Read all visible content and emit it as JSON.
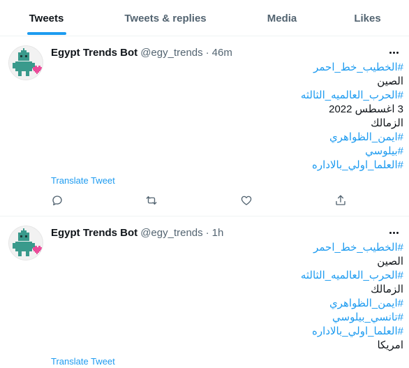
{
  "tabs": [
    {
      "label": "Tweets",
      "active": true
    },
    {
      "label": "Tweets & replies",
      "active": false
    },
    {
      "label": "Media",
      "active": false
    },
    {
      "label": "Likes",
      "active": false
    }
  ],
  "tweets": [
    {
      "display_name": "Egypt Trends Bot",
      "handle": "@egy_trends",
      "separator": "·",
      "time": "46m",
      "lines": [
        {
          "text": "#الخطيب_خط_احمر",
          "hashtag": true
        },
        {
          "text": "الصين",
          "hashtag": false
        },
        {
          "text": "#الحرب_العالميه_الثالثه",
          "hashtag": true
        },
        {
          "text": "3 اغسطس 2022",
          "hashtag": false
        },
        {
          "text": "الزمالك",
          "hashtag": false
        },
        {
          "text": "#ايمن_الظواهري",
          "hashtag": true
        },
        {
          "text": "#بيلوسي",
          "hashtag": true
        },
        {
          "text": "#العلما_اولي_بالاداره",
          "hashtag": true
        }
      ],
      "translate_label": "Translate Tweet"
    },
    {
      "display_name": "Egypt Trends Bot",
      "handle": "@egy_trends",
      "separator": "·",
      "time": "1h",
      "lines": [
        {
          "text": "#الخطيب_خط_احمر",
          "hashtag": true
        },
        {
          "text": "الصين",
          "hashtag": false
        },
        {
          "text": "#الحرب_العالميه_الثالثه",
          "hashtag": true
        },
        {
          "text": "الزمالك",
          "hashtag": false
        },
        {
          "text": "#ايمن_الظواهري",
          "hashtag": true
        },
        {
          "text": "#تانسي_بيلوسي",
          "hashtag": true
        },
        {
          "text": "#العلما_اولي_بالاداره",
          "hashtag": true
        },
        {
          "text": "امريكا",
          "hashtag": false
        }
      ],
      "translate_label": "Translate Tweet"
    }
  ],
  "actions": [
    "reply-icon",
    "retweet-icon",
    "like-icon",
    "share-icon"
  ],
  "colors": {
    "accent": "#1d9bf0",
    "text": "#0f1419",
    "secondary": "#536471",
    "divider": "#eff3f4",
    "avatar_robot": "#3a9a8c",
    "avatar_heart": "#ea4c9a"
  }
}
